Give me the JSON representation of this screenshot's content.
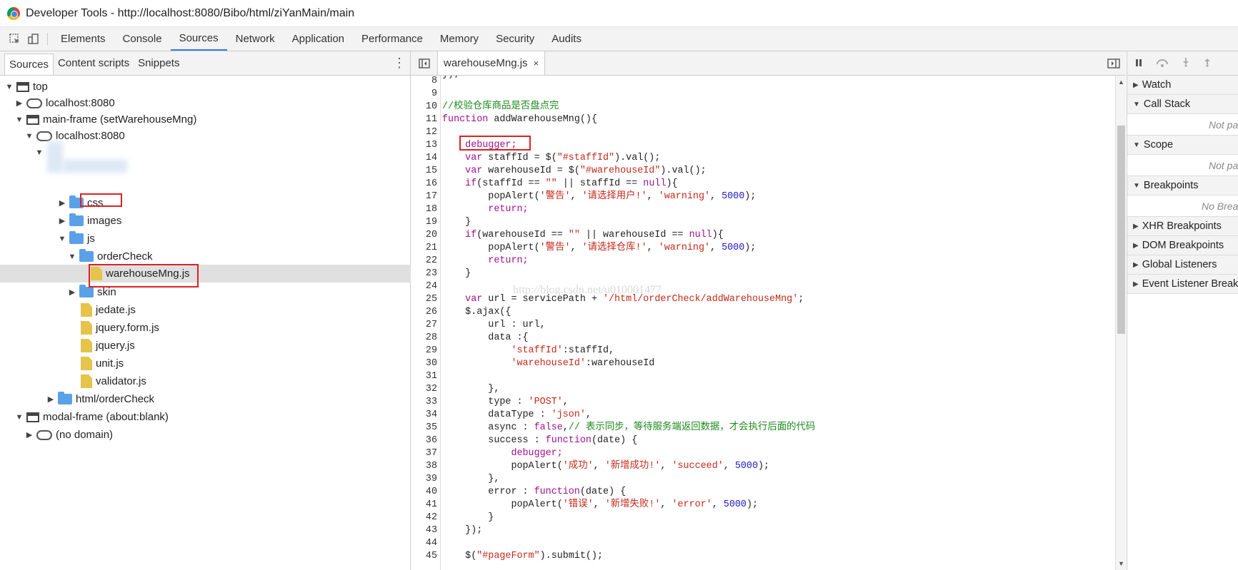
{
  "window": {
    "title": "Developer Tools - http://localhost:8080/Bibo/html/ziYanMain/main"
  },
  "toolbar": {
    "tabs": [
      "Elements",
      "Console",
      "Sources",
      "Network",
      "Application",
      "Performance",
      "Memory",
      "Security",
      "Audits"
    ],
    "active_tab": "Sources"
  },
  "navigator": {
    "tabs": [
      "Sources",
      "Content scripts",
      "Snippets"
    ],
    "tree": [
      {
        "label": "top"
      },
      {
        "label": "localhost:8080"
      },
      {
        "label": "main-frame (setWarehouseMng)"
      },
      {
        "label": "localhost:8080"
      },
      {
        "label": ""
      },
      {
        "label": "css"
      },
      {
        "label": "images"
      },
      {
        "label": "js"
      },
      {
        "label": "orderCheck"
      },
      {
        "label": "warehouseMng.js"
      },
      {
        "label": "skin"
      },
      {
        "label": "jedate.js"
      },
      {
        "label": "jquery.form.js"
      },
      {
        "label": "jquery.js"
      },
      {
        "label": "unit.js"
      },
      {
        "label": "validator.js"
      },
      {
        "label": "html/orderCheck"
      },
      {
        "label": "modal-frame (about:blank)"
      },
      {
        "label": "(no domain)"
      }
    ]
  },
  "editor": {
    "file_tab": "warehouseMng.js",
    "close_glyph": "×",
    "line_numbers": [
      "8",
      "9",
      "10",
      "11",
      "12",
      "13",
      "14",
      "15",
      "16",
      "17",
      "18",
      "19",
      "20",
      "21",
      "22",
      "23",
      "24",
      "25",
      "26",
      "27",
      "28",
      "29",
      "30",
      "31",
      "32",
      "33",
      "34",
      "35",
      "36",
      "37",
      "38",
      "39",
      "40",
      "41",
      "42",
      "43",
      "44",
      "45"
    ],
    "code": {
      "l7": "});",
      "l10": "//校验仓库商品是否盘点完",
      "l11_kw": "function",
      "l11_rest": " addWarehouseMng(){",
      "l13": "debugger;",
      "l14_kw": "var",
      "l14_a": " staffId = $(",
      "l14_s": "\"#staffId\"",
      "l14_b": ").val();",
      "l15_kw": "var",
      "l15_a": " warehouseId = $(",
      "l15_s": "\"#warehouseId\"",
      "l15_b": ").val();",
      "l16_kw": "if",
      "l16_a": "(staffId == ",
      "l16_s": "\"\"",
      "l16_b": " || staffId == ",
      "l16_n": "null",
      "l16_c": "){",
      "l17_a": "popAlert(",
      "l17_s1": "'警告'",
      "l17_s2": "'请选择用户!'",
      "l17_s3": "'warning'",
      "l17_n": "5000",
      "l17_b": ");",
      "l18": "return;",
      "l19": "}",
      "l20_kw": "if",
      "l20_a": "(warehouseId == ",
      "l20_s": "\"\"",
      "l20_b": " || warehouseId == ",
      "l20_n": "null",
      "l20_c": "){",
      "l21_a": "popAlert(",
      "l21_s1": "'警告'",
      "l21_s2": "'请选择仓库!'",
      "l21_s3": "'warning'",
      "l21_n": "5000",
      "l21_b": ");",
      "l22": "return;",
      "l23": "}",
      "l25_kw": "var",
      "l25_a": " url = servicePath + ",
      "l25_s": "'/html/orderCheck/addWarehouseMng'",
      "l25_b": ";",
      "l26": "$.ajax({",
      "l27": "url : url,",
      "l28": "data :{",
      "l29_s": "'staffId'",
      "l29_b": ":staffId,",
      "l30_s": "'warehouseId'",
      "l30_b": ":warehouseId",
      "l32": "},",
      "l33_a": "type : ",
      "l33_s": "'POST'",
      "l33_b": ",",
      "l34_a": "dataType : ",
      "l34_s": "'json'",
      "l34_b": ",",
      "l35_a": "async : ",
      "l35_k": "false",
      "l35_b": ",",
      "l35_c": "// 表示同步，等待服务端返回数据，才会执行后面的代码",
      "l36_a": "success : ",
      "l36_k": "function",
      "l36_b": "(date) {",
      "l37": "debugger;",
      "l38_a": "popAlert(",
      "l38_s1": "'成功'",
      "l38_s2": "'新增成功!'",
      "l38_s3": "'succeed'",
      "l38_n": "5000",
      "l38_b": ");",
      "l39": "},",
      "l40_a": "error : ",
      "l40_k": "function",
      "l40_b": "(date) {",
      "l41_a": "popAlert(",
      "l41_s1": "'错误'",
      "l41_s2": "'新增失败!'",
      "l41_s3": "'error'",
      "l41_n": "5000",
      "l41_b": ");",
      "l42": "}",
      "l43": "});",
      "l45_a": "$(",
      "l45_s": "\"#pageForm\"",
      "l45_b": ").submit();"
    },
    "watermark": "http://blog.csdn.net/u010001477"
  },
  "debugger_sidebar": {
    "sections": [
      "Watch",
      "Call Stack",
      "Scope",
      "Breakpoints",
      "XHR Breakpoints",
      "DOM Breakpoints",
      "Global Listeners",
      "Event Listener Breakpoints"
    ],
    "call_stack_empty": "Not paused",
    "scope_empty": "Not paused",
    "breakpoints_empty": "No Breakpoints"
  }
}
